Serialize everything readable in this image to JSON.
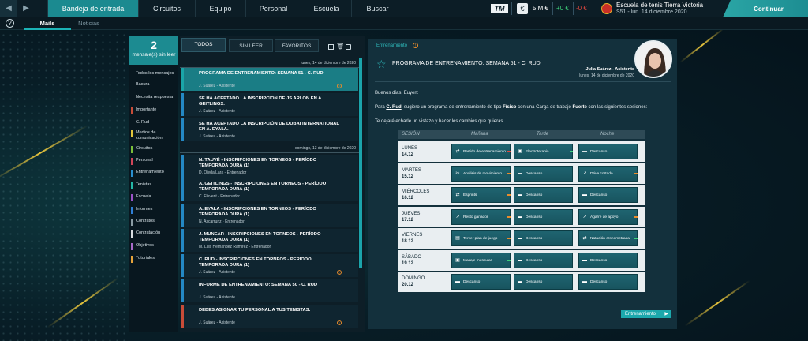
{
  "nav": {
    "prev": "◀",
    "next": "▶",
    "items": [
      {
        "label": "Bandeja de entrada",
        "active": true
      },
      {
        "label": "Circuitos"
      },
      {
        "label": "Equipo"
      },
      {
        "label": "Personal"
      },
      {
        "label": "Escuela"
      },
      {
        "label": "Buscar"
      }
    ]
  },
  "status": {
    "logo": "TM",
    "money": "5 M €",
    "income": "+0 €",
    "expense": "-0 €",
    "club_name": "Escuela de tenis Tierra Victoria",
    "club_date": "S51 - lun. 14 diciembre 2020",
    "continue": "Continuar"
  },
  "subtabs": {
    "help": "?",
    "mails": "Mails",
    "news": "Noticias"
  },
  "folders": {
    "unread_count": "2",
    "unread_label": "mensaje(s) sin leer",
    "items": [
      {
        "label": "Todos los mensajes",
        "color": ""
      },
      {
        "label": "Basura",
        "color": ""
      },
      {
        "label": "Necesita respuesta",
        "color": ""
      },
      {
        "label": "Importante",
        "color": "#c84c38"
      },
      {
        "label": "C. Rud",
        "color": ""
      },
      {
        "label": "Medios de comunicación",
        "color": "#e2c53b"
      },
      {
        "label": "Circuitos",
        "color": "#7bbf3a"
      },
      {
        "label": "Personal",
        "color": "#d2465a"
      },
      {
        "label": "Entrenamiento",
        "color": "#2a8fd0"
      },
      {
        "label": "Tenistas",
        "color": "#24b6a6"
      },
      {
        "label": "Escuela",
        "color": "#9b52c8"
      },
      {
        "label": "Informes",
        "color": "#2f7fd6"
      },
      {
        "label": "Contratos",
        "color": "#8a9ba3"
      },
      {
        "label": "Contratación",
        "color": "#d8dde0"
      },
      {
        "label": "Objetivos",
        "color": "#a86ac9"
      },
      {
        "label": "Tutoriales",
        "color": "#e5a33a"
      }
    ]
  },
  "list": {
    "tabs": [
      "TODOS",
      "SIN LEER",
      "FAVORITOS"
    ],
    "date1": "lunes, 14 de diciembre de 2020",
    "date2": "domingo, 13 de diciembre de 2020",
    "messages": [
      {
        "title": "PROGRAMA DE ENTRENAMIENTO: SEMANA 51 - C. RUD",
        "from": "J. Suárez - Asistente",
        "color": "#1aa5a8",
        "warn": true
      },
      {
        "title": "SE HA ACEPTADO LA INSCRIPCIÓN DE JS ARLON EN A. GEITLINGS.",
        "from": "J. Suárez - Asistente",
        "color": "#2488c4",
        "warn": false
      },
      {
        "title": "SE HA ACEPTADO LA INSCRIPCIÓN DE DUBAI INTERNATIONAL EN A. EYALA.",
        "from": "J. Suárez - Asistente",
        "color": "#2488c4",
        "warn": false
      },
      {
        "title": "N. TAUVÉ - INSCRIPCIONES EN TORNEOS - PERÍODO TEMPORADA DURA (1)",
        "from": "D. Ojeda Lara - Entrenador",
        "color": "#2488c4",
        "warn": false
      },
      {
        "title": "A. GEITLINGS - INSCRIPCIONES EN TORNEOS - PERÍODO TEMPORADA DURA (1)",
        "from": "C. Fluvent - Entrenador",
        "color": "#2488c4",
        "warn": false
      },
      {
        "title": "A. EYALA - INSCRIPCIONES EN TORNEOS - PERÍODO TEMPORADA DURA (1)",
        "from": "N. Ascarrunz - Entrenador",
        "color": "#2488c4",
        "warn": false
      },
      {
        "title": "J. MUNEAR - INSCRIPCIONES EN TORNEOS - PERÍODO TEMPORADA DURA (1)",
        "from": "M. Luis Hernandez Ramirez - Entrenador",
        "color": "#2488c4",
        "warn": false
      },
      {
        "title": "C. RUD - INSCRIPCIONES EN TORNEOS - PERÍODO TEMPORADA DURA (1)",
        "from": "J. Suárez - Asistente",
        "color": "#2488c4",
        "warn": true
      },
      {
        "title": "INFORME DE ENTRENAMIENTO: SEMANA 50 - C. RUD",
        "from": "J. Suárez - Asistente",
        "color": "#2488c4",
        "warn": false
      },
      {
        "title": "DEBES ASIGNAR TU PERSONAL A TUS TENISTAS.",
        "from": "J. Suárez - Asistente",
        "color": "#c84c38",
        "warn": true
      }
    ]
  },
  "detail": {
    "category": "Entrenamiento",
    "title": "PROGRAMA DE ENTRENAMIENTO: SEMANA 51 - C. RUD",
    "sender": "Julia Suárez - Asistente",
    "date": "lunes, 14 de diciembre de 2020",
    "greeting": "Buenos días, Euyen:",
    "p1_a": "Para ",
    "p1_player": "C. Rud",
    "p1_b": ", sugiero un programa de entrenamiento de tipo ",
    "p1_type": "Físico",
    "p1_c": " con una Carga de trabajo ",
    "p1_load": "Fuerte",
    "p1_d": " con las siguientes sesiones:",
    "p2": "Te dejaré echarle un vistazo y hacer los cambios que quieras.",
    "cta": "Entrenamiento"
  },
  "schedule": {
    "headers": [
      "SESIÓN",
      "Mañana",
      "Tarde",
      "Noche"
    ],
    "rows": [
      {
        "day": "LUNES",
        "date": "14.12",
        "cells": [
          {
            "label": "Partido de entrenamiento",
            "icon": "⇄",
            "mark": "#e2473f"
          },
          {
            "label": "Electroterapia",
            "icon": "▣",
            "mark": "#3ed07a"
          },
          {
            "label": "Descanso",
            "icon": "▬",
            "mark": ""
          }
        ]
      },
      {
        "day": "MARTES",
        "date": "15.12",
        "cells": [
          {
            "label": "Análisis de movimiento",
            "icon": "✂",
            "mark": "#e98c2b"
          },
          {
            "label": "Descanso",
            "icon": "▬",
            "mark": ""
          },
          {
            "label": "Drive cortado",
            "icon": "↗",
            "mark": "#e98c2b"
          }
        ]
      },
      {
        "day": "MIÉRCOLES",
        "date": "16.12",
        "cells": [
          {
            "label": "Esprints",
            "icon": "⇄",
            "mark": "#e98c2b"
          },
          {
            "label": "Descanso",
            "icon": "▬",
            "mark": ""
          },
          {
            "label": "Descanso",
            "icon": "▬",
            "mark": ""
          }
        ]
      },
      {
        "day": "JUEVES",
        "date": "17.12",
        "cells": [
          {
            "label": "Resto ganador",
            "icon": "↗",
            "mark": "#e98c2b"
          },
          {
            "label": "Descanso",
            "icon": "▬",
            "mark": ""
          },
          {
            "label": "Agarre de apoyo",
            "icon": "↗",
            "mark": "#e98c2b"
          }
        ]
      },
      {
        "day": "VIERNES",
        "date": "18.12",
        "cells": [
          {
            "label": "Tercer plan de juego",
            "icon": "▤",
            "mark": "#e98c2b"
          },
          {
            "label": "Descanso",
            "icon": "▬",
            "mark": ""
          },
          {
            "label": "Natación cronometrada",
            "icon": "⇄",
            "mark": "#3ed07a"
          }
        ]
      },
      {
        "day": "SÁBADO",
        "date": "19.12",
        "cells": [
          {
            "label": "Masaje muscular",
            "icon": "▣",
            "mark": "#3ed07a"
          },
          {
            "label": "Descanso",
            "icon": "▬",
            "mark": ""
          },
          {
            "label": "Descanso",
            "icon": "▬",
            "mark": ""
          }
        ]
      },
      {
        "day": "DOMINGO",
        "date": "20.12",
        "cells": [
          {
            "label": "Descanso",
            "icon": "▬",
            "mark": ""
          },
          {
            "label": "Descanso",
            "icon": "▬",
            "mark": ""
          },
          {
            "label": "Descanso",
            "icon": "▬",
            "mark": ""
          }
        ]
      }
    ]
  }
}
